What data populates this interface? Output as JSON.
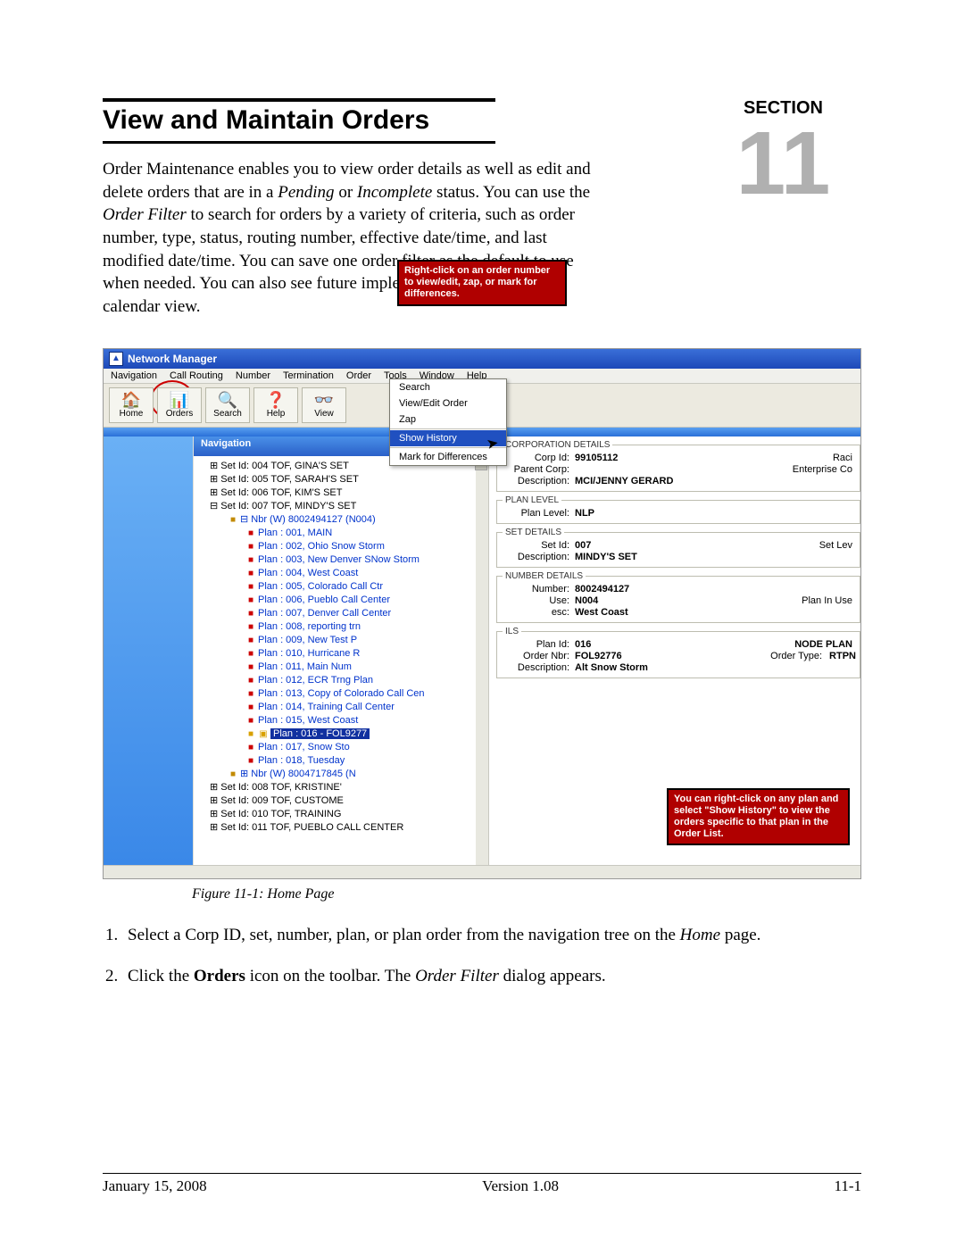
{
  "doc": {
    "title": "View and Maintain Orders",
    "section_label": "SECTION",
    "section_number": "11",
    "intro_html": "Order Maintenance enables you to view order details as well as edit and delete orders that are in a <em>Pending</em> or <em>Incomplete</em> status. You can use the <em>Order Filter</em> to search for orders by a variety of criteria, such as order number, type, status, routing number, effective date/time, and last modified date/time. You can save one order filter as the default to use when needed. You can also see future implementations through the calendar view.",
    "figure_caption": "Figure 11-1:   Home Page",
    "step1_html": "Select a Corp ID, set, number, plan, or plan order from the navigation tree on the <em>Home</em> page.",
    "step2_html": "Click the <b>Orders</b> icon on the toolbar. The <em>Order Filter</em> dialog appears.",
    "footer_date": "January 15, 2008",
    "footer_version": "Version 1.08",
    "footer_page": "11-1"
  },
  "app": {
    "window_title": "Network Manager",
    "menus": [
      "Navigation",
      "Call Routing",
      "Number",
      "Termination",
      "Order",
      "Tools",
      "Window",
      "Help"
    ],
    "toolbar": [
      {
        "icon": "🏠",
        "label": "Home"
      },
      {
        "icon": "📊",
        "label": "Orders"
      },
      {
        "icon": "🔍",
        "label": "Search"
      },
      {
        "icon": "❓",
        "label": "Help"
      },
      {
        "icon": "👓",
        "label": "View"
      }
    ],
    "nav_title": "Navigation",
    "tree": {
      "sets_top": [
        "Set Id:  004 TOF, GINA'S SET",
        "Set Id:  005 TOF, SARAH'S SET",
        "Set Id:  006 TOF, KIM'S SET",
        "Set Id:  007 TOF, MINDY'S SET"
      ],
      "number_line": "Nbr (W) 8002494127 (N004)",
      "plans": [
        "Plan : 001, MAIN",
        "Plan : 002, Ohio Snow Storm",
        "Plan : 003, New Denver SNow Storm",
        "Plan : 004, West Coast",
        "Plan : 005, Colorado Call Ctr",
        "Plan : 006, Pueblo Call Center",
        "Plan : 007, Denver Call Center",
        "Plan : 008, reporting trn",
        "Plan : 009, New Test P",
        "Plan : 010, Hurricane R",
        "Plan : 011, Main Num",
        "Plan : 012, ECR Trng Plan",
        "Plan : 013, Copy of Colorado Call Cen",
        "Plan : 014, Training Call Center",
        "Plan : 015, West Coast",
        "Plan : 017, Snow Sto",
        "Plan : 018, Tuesday"
      ],
      "selected_plan": "Plan : 016 - FOL9277",
      "number_line2": "Nbr (W) 8004717845 (N",
      "sets_bottom": [
        "Set Id:  008 TOF, KRISTINE'",
        "Set Id:  009 TOF, CUSTOME",
        "Set Id:  010 TOF, TRAINING",
        "Set Id:  011 TOF, PUEBLO CALL CENTER"
      ]
    },
    "detail": {
      "corp_legend": "CORPORATION DETAILS",
      "corp_id_lbl": "Corp Id:",
      "corp_id": "99105112",
      "corp_rt": "Raci",
      "parent_lbl": "Parent Corp:",
      "parent_rt": "Enterprise Co",
      "desc_lbl": "Description:",
      "desc": "MCI/JENNY GERARD",
      "plan_legend": "PLAN LEVEL",
      "plan_lvl_lbl": "Plan Level:",
      "plan_lvl": "NLP",
      "set_legend": "SET DETAILS",
      "set_id_lbl": "Set Id:",
      "set_id": "007",
      "set_rt": "Set Lev",
      "set_desc_lbl": "Description:",
      "set_desc": "MINDY'S SET",
      "num_legend": "NUMBER DETAILS",
      "num_lbl": "Number:",
      "num": "8002494127",
      "use_lbl": "Use:",
      "use": "N004",
      "use_rt": "Plan In Use",
      "esc_lbl": "esc:",
      "esc": "West Coast",
      "ils_legend": "ILS",
      "pid_lbl": "Plan Id:",
      "pid": "016",
      "pid_link": "NODE PLAN",
      "onbr_lbl": "Order Nbr:",
      "onbr": "FOL92776",
      "otype_lbl": "Order Type:",
      "otype": "RTPN",
      "odesc_lbl": "Description:",
      "odesc": "Alt Snow Storm"
    },
    "context_menu": [
      "Search",
      "View/Edit Order",
      "Zap",
      "Show History",
      "Mark for Differences"
    ],
    "callout1": "Right-click on an order number to view/edit, zap, or mark for differences.",
    "callout2": "You can right-click on any plan and select \"Show History\" to view the orders specific to that plan in the Order List."
  }
}
